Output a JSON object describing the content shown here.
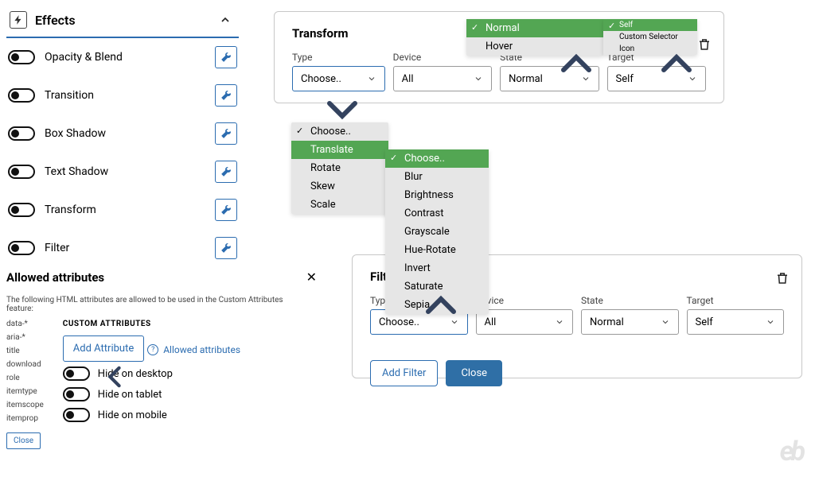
{
  "sidebar": {
    "title": "Effects",
    "items": [
      {
        "label": "Opacity & Blend"
      },
      {
        "label": "Transition"
      },
      {
        "label": "Box Shadow"
      },
      {
        "label": "Text Shadow"
      },
      {
        "label": "Transform"
      },
      {
        "label": "Filter"
      }
    ]
  },
  "allowed": {
    "heading": "Allowed attributes",
    "description": "The following HTML attributes are allowed to be used in the Custom Attributes feature:",
    "list": [
      "data-*",
      "aria-*",
      "title",
      "download",
      "role",
      "itemtype",
      "itemscope",
      "itemprop"
    ],
    "close": "Close",
    "custom_heading": "CUSTOM ATTRIBUTES",
    "add_attribute": "Add Attribute",
    "link_label": "Allowed attributes",
    "hide_desktop": "Hide on desktop",
    "hide_tablet": "Hide on tablet",
    "hide_mobile": "Hide on mobile"
  },
  "transform_card": {
    "title": "Transform",
    "fields": {
      "type": {
        "caption": "Type",
        "value": "Choose.."
      },
      "device": {
        "caption": "Device",
        "value": "All"
      },
      "state": {
        "caption": "State",
        "value": "Normal"
      },
      "target": {
        "caption": "Target",
        "value": "Self"
      }
    }
  },
  "filter_card": {
    "title": "Filter",
    "fields": {
      "type": {
        "caption": "Type",
        "value": "Choose.."
      },
      "device": {
        "caption": "Device",
        "value": "All"
      },
      "state": {
        "caption": "State",
        "value": "Normal"
      },
      "target": {
        "caption": "Target",
        "value": "Self"
      }
    },
    "add_filter": "Add Filter",
    "close": "Close"
  },
  "dropdowns": {
    "transform_type": {
      "options": [
        {
          "label": "Choose..",
          "checked": true
        },
        {
          "label": "Translate",
          "selected": true
        },
        {
          "label": "Rotate"
        },
        {
          "label": "Skew"
        },
        {
          "label": "Scale"
        }
      ]
    },
    "filter_type": {
      "options": [
        {
          "label": "Choose..",
          "checked": true,
          "selected": true
        },
        {
          "label": "Blur"
        },
        {
          "label": "Brightness"
        },
        {
          "label": "Contrast"
        },
        {
          "label": "Grayscale"
        },
        {
          "label": "Hue-Rotate"
        },
        {
          "label": "Invert"
        },
        {
          "label": "Saturate"
        },
        {
          "label": "Sepia"
        }
      ]
    },
    "state": {
      "options": [
        {
          "label": "Normal",
          "checked": true,
          "selected": true
        },
        {
          "label": "Hover"
        }
      ]
    },
    "target": {
      "options": [
        {
          "label": "Self",
          "checked": true,
          "selected": true
        },
        {
          "label": "Custom Selector"
        },
        {
          "label": "Icon"
        }
      ]
    }
  },
  "watermark": "eb"
}
